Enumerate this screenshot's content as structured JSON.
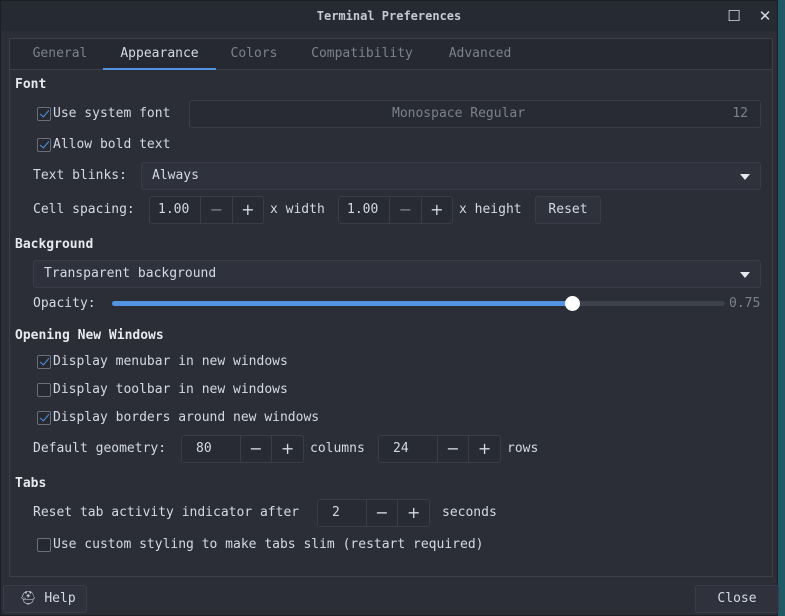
{
  "window": {
    "title": "Terminal Preferences",
    "maximize_icon": "maximize-icon",
    "close_icon": "close-icon"
  },
  "tabs": [
    {
      "label": "General"
    },
    {
      "label": "Appearance",
      "active": true
    },
    {
      "label": "Colors"
    },
    {
      "label": "Compatibility"
    },
    {
      "label": "Advanced"
    }
  ],
  "font": {
    "heading": "Font",
    "use_system_font": {
      "label": "Use system font",
      "checked": true
    },
    "font_name": "Monospace Regular",
    "font_size": "12",
    "allow_bold": {
      "label": "Allow bold text",
      "checked": true
    },
    "text_blinks_label": "Text blinks:",
    "text_blinks_value": "Always",
    "cell_spacing_label": "Cell spacing:",
    "width_value": "1.00",
    "width_label": "x width",
    "height_value": "1.00",
    "height_label": "x height",
    "reset_label": "Reset"
  },
  "background": {
    "heading": "Background",
    "mode": "Transparent background",
    "opacity_label": "Opacity:",
    "opacity_value": 0.75,
    "opacity_text": "0.75"
  },
  "new_windows": {
    "heading": "Opening New Windows",
    "menubar": {
      "label": "Display menubar in new windows",
      "checked": true
    },
    "toolbar": {
      "label": "Display toolbar in new windows",
      "checked": false
    },
    "borders": {
      "label": "Display borders around new windows",
      "checked": true
    },
    "geometry_label": "Default geometry:",
    "columns_value": "80",
    "columns_label": "columns",
    "rows_value": "24",
    "rows_label": "rows"
  },
  "tabs_section": {
    "heading": "Tabs",
    "reset_label": "Reset tab activity indicator after",
    "reset_value": "2",
    "seconds_label": "seconds",
    "slim": {
      "label": "Use custom styling to make tabs slim (restart required)",
      "checked": false
    }
  },
  "footer": {
    "help_label": "Help",
    "help_icon": "lifebuoy-icon",
    "close_label": "Close"
  },
  "spin_minus": "−",
  "spin_plus": "+",
  "colors": {
    "accent": "#5294e2",
    "background": "#2b2e37"
  }
}
